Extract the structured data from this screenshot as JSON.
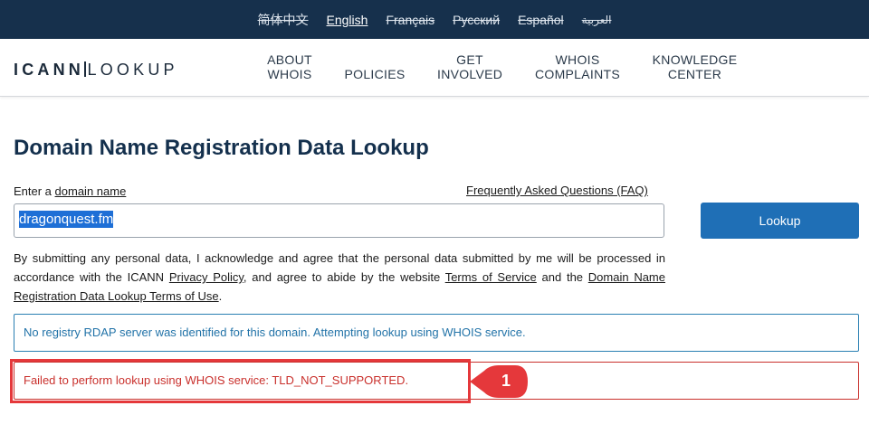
{
  "languages": [
    {
      "label": "简体中文",
      "active": false
    },
    {
      "label": "English",
      "active": true
    },
    {
      "label": "Français",
      "active": false
    },
    {
      "label": "Русский",
      "active": false
    },
    {
      "label": "Español",
      "active": false
    },
    {
      "label": "العربية",
      "active": false
    }
  ],
  "logo": {
    "part1": "ICANN",
    "part2": "LOOKUP"
  },
  "nav": [
    {
      "line1": "ABOUT",
      "line2": "WHOIS"
    },
    {
      "line1": "",
      "line2": "POLICIES"
    },
    {
      "line1": "GET",
      "line2": "INVOLVED"
    },
    {
      "line1": "WHOIS",
      "line2": "COMPLAINTS"
    },
    {
      "line1": "KNOWLEDGE",
      "line2": "CENTER"
    }
  ],
  "page": {
    "title": "Domain Name Registration Data Lookup",
    "label_prefix": "Enter a ",
    "label_link": "domain name",
    "faq": "Frequently Asked Questions (FAQ)",
    "input_value": "dragonquest.fm",
    "lookup_label": "Lookup"
  },
  "disclaimer": {
    "part1": "By submitting any personal data, I acknowledge and agree that the personal data submitted by me will be processed in accordance with the ICANN ",
    "privacy": "Privacy Policy",
    "part2": ", and agree to abide by the website ",
    "tos": "Terms of Service",
    "part3": " and the ",
    "terms_of_use": "Domain Name Registration Data Lookup Terms of Use",
    "part4": "."
  },
  "messages": {
    "info": "No registry RDAP server was identified for this domain. Attempting lookup using WHOIS service.",
    "error": "Failed to perform lookup using WHOIS service: TLD_NOT_SUPPORTED."
  },
  "annotation": {
    "number": "1"
  },
  "colors": {
    "brand_dark": "#16304c",
    "button": "#1f6fb6",
    "info": "#2273a8",
    "error": "#c9302c",
    "callout": "#e5383b"
  }
}
